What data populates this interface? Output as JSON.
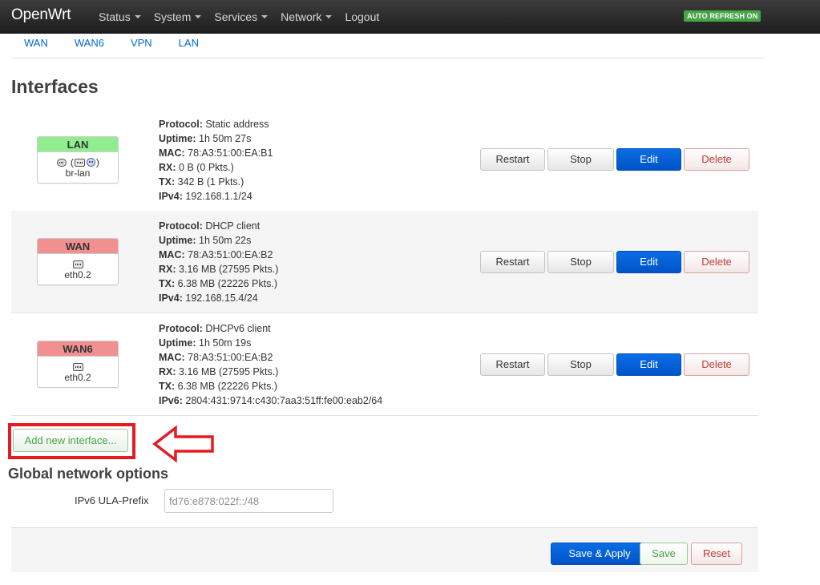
{
  "app": {
    "brand": "OpenWrt",
    "auto_refresh": "AUTO REFRESH ON"
  },
  "menu": [
    {
      "label": "Status",
      "has_dropdown": true
    },
    {
      "label": "System",
      "has_dropdown": true
    },
    {
      "label": "Services",
      "has_dropdown": true
    },
    {
      "label": "Network",
      "has_dropdown": true
    },
    {
      "label": "Logout",
      "has_dropdown": false
    }
  ],
  "subtabs": [
    "WAN",
    "WAN6",
    "VPN",
    "LAN"
  ],
  "page_title": "Interfaces",
  "interfaces": [
    {
      "name": "LAN",
      "color": "#90ee90",
      "device": "br-lan",
      "icons": [
        "bridge-icon",
        "ethernet-icon",
        "wifi-icon"
      ],
      "details": [
        {
          "key": "Protocol:",
          "value": "Static address"
        },
        {
          "key": "Uptime:",
          "value": "1h 50m 27s"
        },
        {
          "key": "MAC:",
          "value": "78:A3:51:00:EA:B1"
        },
        {
          "key": "RX:",
          "value": "0 B (0 Pkts.)"
        },
        {
          "key": "TX:",
          "value": "342 B (1 Pkts.)"
        },
        {
          "key": "IPv4:",
          "value": "192.168.1.1/24"
        }
      ]
    },
    {
      "name": "WAN",
      "color": "#f09090",
      "device": "eth0.2",
      "icons": [
        "ethernet-icon"
      ],
      "details": [
        {
          "key": "Protocol:",
          "value": "DHCP client"
        },
        {
          "key": "Uptime:",
          "value": "1h 50m 22s"
        },
        {
          "key": "MAC:",
          "value": "78:A3:51:00:EA:B2"
        },
        {
          "key": "RX:",
          "value": "3.16 MB (27595 Pkts.)"
        },
        {
          "key": "TX:",
          "value": "6.38 MB (22226 Pkts.)"
        },
        {
          "key": "IPv4:",
          "value": "192.168.15.4/24"
        }
      ]
    },
    {
      "name": "WAN6",
      "color": "#f09090",
      "device": "eth0.2",
      "icons": [
        "ethernet-icon"
      ],
      "details": [
        {
          "key": "Protocol:",
          "value": "DHCPv6 client"
        },
        {
          "key": "Uptime:",
          "value": "1h 50m 19s"
        },
        {
          "key": "MAC:",
          "value": "78:A3:51:00:EA:B2"
        },
        {
          "key": "RX:",
          "value": "3.16 MB (27595 Pkts.)"
        },
        {
          "key": "TX:",
          "value": "6.38 MB (22226 Pkts.)"
        },
        {
          "key": "IPv6:",
          "value": "2804:431:9714:c430:7aa3:51ff:fe00:eab2/64"
        }
      ]
    }
  ],
  "row_buttons": {
    "restart": "Restart",
    "stop": "Stop",
    "edit": "Edit",
    "delete": "Delete"
  },
  "add_interface": {
    "label": "Add new interface..."
  },
  "global": {
    "title": "Global network options",
    "ula_label": "IPv6 ULA-Prefix",
    "ula_placeholder": "fd76:e878:022f::/48"
  },
  "footer": {
    "save_apply": "Save & Apply",
    "save": "Save",
    "reset": "Reset"
  },
  "colors": {
    "brand_accent": "#0069d6",
    "primary_button": "#0a6ee6",
    "success": "#46a546",
    "danger": "#c43c35",
    "annotation": "#e41b23"
  }
}
